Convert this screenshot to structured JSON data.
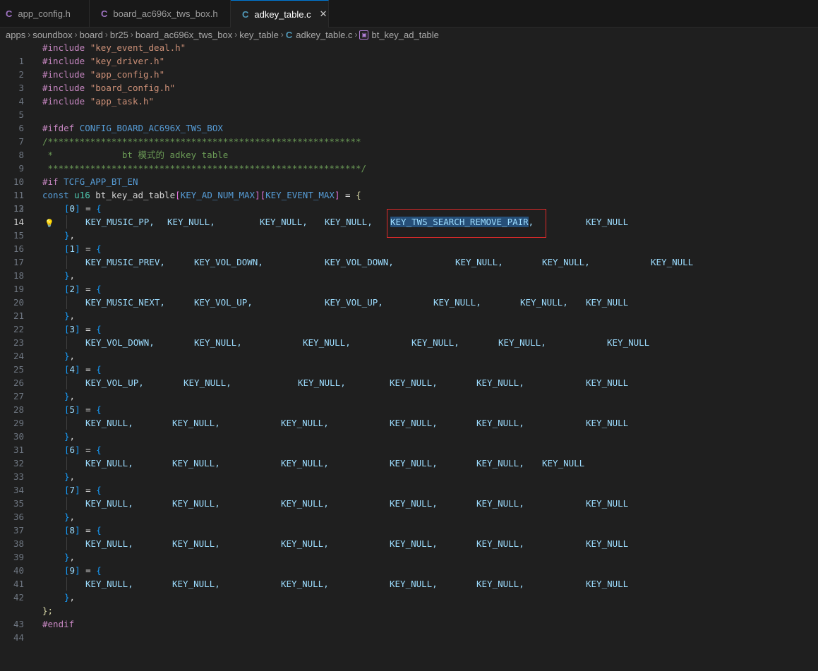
{
  "tabs": [
    {
      "icon": "C",
      "label": "app_config.h"
    },
    {
      "icon": "C",
      "label": "board_ac696x_tws_box.h"
    },
    {
      "icon": "C",
      "label": "adkey_table.c",
      "close": "✕"
    }
  ],
  "breadcrumb": [
    "apps",
    "soundbox",
    "board",
    "br25",
    "board_ac696x_tws_box",
    "key_table",
    "adkey_table.c",
    "bt_key_ad_table"
  ],
  "lines": {
    "l1a": "#include",
    "l1b": "\"key_event_deal.h\"",
    "l2a": "#include",
    "l2b": "\"key_driver.h\"",
    "l3a": "#include",
    "l3b": "\"app_config.h\"",
    "l4a": "#include",
    "l4b": "\"board_config.h\"",
    "l5a": "#include",
    "l5b": "\"app_task.h\"",
    "l7a": "#ifdef",
    "l7b": "CONFIG_BOARD_AC696X_TWS_BOX",
    "l8": "/***********************************************************",
    "l9": " *             bt 模式的 adkey table",
    "l10": " ***********************************************************/",
    "l11a": "#if",
    "l11b": "TCFG_APP_BT_EN",
    "l12a": "const",
    "l12b": "u16",
    "l12c": "bt_key_ad_table",
    "l12d": "[",
    "l12e": "KEY_AD_NUM_MAX",
    "l12f": "][",
    "l12g": "KEY_EVENT_MAX",
    "l12h": "]",
    "l12i": " = ",
    "l12j": "{",
    "l43": "};",
    "l44": "#endif"
  },
  "rows": [
    {
      "index": "0",
      "keys": [
        "KEY_MUSIC_PP,",
        "KEY_NULL,",
        "KEY_NULL,",
        "KEY_NULL,",
        "KEY_TWS_SEARCH_REMOVE_PAIR,",
        "KEY_NULL"
      ]
    },
    {
      "index": "1",
      "keys": [
        "KEY_MUSIC_PREV,",
        "KEY_VOL_DOWN,",
        "KEY_VOL_DOWN,",
        "KEY_NULL,",
        "KEY_NULL,",
        "KEY_NULL"
      ]
    },
    {
      "index": "2",
      "keys": [
        "KEY_MUSIC_NEXT,",
        "KEY_VOL_UP,",
        "KEY_VOL_UP,",
        "KEY_NULL,",
        "KEY_NULL,",
        "KEY_NULL"
      ]
    },
    {
      "index": "3",
      "keys": [
        "KEY_VOL_DOWN,",
        "KEY_NULL,",
        "KEY_NULL,",
        "KEY_NULL,",
        "KEY_NULL,",
        "KEY_NULL"
      ]
    },
    {
      "index": "4",
      "keys": [
        "KEY_VOL_UP,",
        "KEY_NULL,",
        "KEY_NULL,",
        "KEY_NULL,",
        "KEY_NULL,",
        "KEY_NULL"
      ]
    },
    {
      "index": "5",
      "keys": [
        "KEY_NULL,",
        "KEY_NULL,",
        "KEY_NULL,",
        "KEY_NULL,",
        "KEY_NULL,",
        "KEY_NULL"
      ]
    },
    {
      "index": "6",
      "keys": [
        "KEY_NULL,",
        "KEY_NULL,",
        "KEY_NULL,",
        "KEY_NULL,",
        "KEY_NULL,",
        "KEY_NULL"
      ]
    },
    {
      "index": "7",
      "keys": [
        "KEY_NULL,",
        "KEY_NULL,",
        "KEY_NULL,",
        "KEY_NULL,",
        "KEY_NULL,",
        "KEY_NULL"
      ]
    },
    {
      "index": "8",
      "keys": [
        "KEY_NULL,",
        "KEY_NULL,",
        "KEY_NULL,",
        "KEY_NULL,",
        "KEY_NULL,",
        "KEY_NULL"
      ]
    },
    {
      "index": "9",
      "keys": [
        "KEY_NULL,",
        "KEY_NULL,",
        "KEY_NULL,",
        "KEY_NULL,",
        "KEY_NULL,",
        "KEY_NULL"
      ]
    }
  ],
  "current_line": 14,
  "line_count": 44,
  "colors": {
    "highlight": "#e02a2a",
    "selection": "#264f78",
    "accent": "#0078d4"
  }
}
